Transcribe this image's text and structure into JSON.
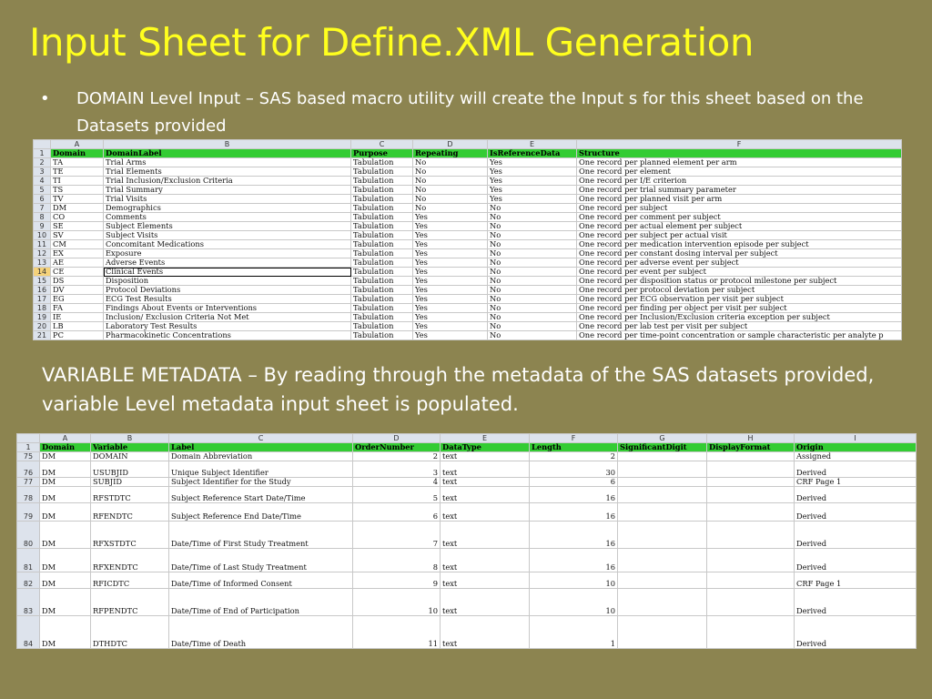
{
  "slide": {
    "title": "Input Sheet for Define.XML Generation",
    "bullet_marker": "•",
    "bullet_text": "DOMAIN Level Input – SAS based macro utility will create the Input s for this sheet based on the Datasets provided",
    "paragraph": "VARIABLE METADATA – By reading through the metadata of the SAS datasets provided, variable Level metadata input sheet is populated."
  },
  "domain_sheet": {
    "column_letters": [
      "A",
      "B",
      "C",
      "D",
      "E",
      "F"
    ],
    "header_row_number": "1",
    "headers": [
      "Domain",
      "DomainLabel",
      "Purpose",
      "Repeating",
      "IsReferenceData",
      "Structure"
    ],
    "selected_row": "14",
    "rows": [
      {
        "n": "2",
        "cells": [
          "TA",
          "Trial Arms",
          "Tabulation",
          "No",
          "Yes",
          "One record per planned element per arm"
        ]
      },
      {
        "n": "3",
        "cells": [
          "TE",
          "Trial Elements",
          "Tabulation",
          "No",
          "Yes",
          "One record per element"
        ]
      },
      {
        "n": "4",
        "cells": [
          "TI",
          "Trial Inclusion/Exclusion Criteria",
          "Tabulation",
          "No",
          "Yes",
          "One record per I/E criterion"
        ]
      },
      {
        "n": "5",
        "cells": [
          "TS",
          "Trial Summary",
          "Tabulation",
          "No",
          "Yes",
          "One record per trial summary parameter"
        ]
      },
      {
        "n": "6",
        "cells": [
          "TV",
          "Trial Visits",
          "Tabulation",
          "No",
          "Yes",
          "One record per planned visit per arm"
        ]
      },
      {
        "n": "7",
        "cells": [
          "DM",
          "Demographics",
          "Tabulation",
          "No",
          "No",
          "One record per subject"
        ]
      },
      {
        "n": "8",
        "cells": [
          "CO",
          "Comments",
          "Tabulation",
          "Yes",
          "No",
          "One record per comment per subject"
        ]
      },
      {
        "n": "9",
        "cells": [
          "SE",
          "Subject Elements",
          "Tabulation",
          "Yes",
          "No",
          "One record per actual element per subject"
        ]
      },
      {
        "n": "10",
        "cells": [
          "SV",
          "Subject Visits",
          "Tabulation",
          "Yes",
          "No",
          "One record per subject per actual visit"
        ]
      },
      {
        "n": "11",
        "cells": [
          "CM",
          "Concomitant Medications",
          "Tabulation",
          "Yes",
          "No",
          "One record per medication intervention episode per subject"
        ]
      },
      {
        "n": "12",
        "cells": [
          "EX",
          "Exposure",
          "Tabulation",
          "Yes",
          "No",
          "One record per constant dosing interval per subject"
        ]
      },
      {
        "n": "13",
        "cells": [
          "AE",
          "Adverse Events",
          "Tabulation",
          "Yes",
          "No",
          "One record per adverse event per subject"
        ]
      },
      {
        "n": "14",
        "cells": [
          "CE",
          "Clinical Events",
          "Tabulation",
          "Yes",
          "No",
          "One record per event per subject"
        ]
      },
      {
        "n": "15",
        "cells": [
          "DS",
          "Disposition",
          "Tabulation",
          "Yes",
          "No",
          "One record per disposition status or protocol milestone per subject"
        ]
      },
      {
        "n": "16",
        "cells": [
          "DV",
          "Protocol Deviations",
          "Tabulation",
          "Yes",
          "No",
          "One record per protocol deviation per subject"
        ]
      },
      {
        "n": "17",
        "cells": [
          "EG",
          "ECG Test Results",
          "Tabulation",
          "Yes",
          "No",
          "One record per ECG observation per visit per subject"
        ]
      },
      {
        "n": "18",
        "cells": [
          "FA",
          "Findings About Events or Interventions",
          "Tabulation",
          "Yes",
          "No",
          "One record per finding per object per visit per subject"
        ]
      },
      {
        "n": "19",
        "cells": [
          "IE",
          "Inclusion/ Exclusion Criteria Not Met",
          "Tabulation",
          "Yes",
          "No",
          "One record per Inclusion/Exclusion criteria exception per subject"
        ]
      },
      {
        "n": "20",
        "cells": [
          "LB",
          "Laboratory Test Results",
          "Tabulation",
          "Yes",
          "No",
          "One record per lab test per visit per subject"
        ]
      },
      {
        "n": "21",
        "cells": [
          "PC",
          "Pharmacokinetic Concentrations",
          "Tabulation",
          "Yes",
          "No",
          "One record per time-point concentration or sample characteristic per analyte p"
        ]
      }
    ]
  },
  "variable_sheet": {
    "column_letters": [
      "A",
      "B",
      "C",
      "D",
      "E",
      "F",
      "G",
      "H",
      "I"
    ],
    "header_row_number": "1",
    "headers": [
      "Domain",
      "Variable",
      "Label",
      "OrderNumber",
      "DataType",
      "Length",
      "SignificantDigit",
      "DisplayFormat",
      "Origin"
    ],
    "rows": [
      {
        "n": "75",
        "cells": [
          "DM",
          "DOMAIN",
          "Domain Abbreviation",
          "2",
          "text",
          "2",
          "",
          "",
          "Assigned"
        ]
      },
      {
        "n": "76",
        "cells": [
          "DM",
          "USUBJID",
          "Unique Subject Identifier",
          "3",
          "text",
          "30",
          "",
          "",
          "Derived"
        ]
      },
      {
        "n": "77",
        "cells": [
          "DM",
          "SUBJID",
          "Subject Identifier for the Study",
          "4",
          "text",
          "6",
          "",
          "",
          "CRF Page 1"
        ]
      },
      {
        "n": "78",
        "cells": [
          "DM",
          "RFSTDTC",
          "Subject Reference Start Date/Time",
          "5",
          "text",
          "16",
          "",
          "",
          "Derived"
        ]
      },
      {
        "n": "79",
        "cells": [
          "DM",
          "RFENDTC",
          "Subject Reference End Date/Time",
          "6",
          "text",
          "16",
          "",
          "",
          "Derived"
        ]
      },
      {
        "n": "80",
        "cells": [
          "DM",
          "RFXSTDTC",
          "Date/Time of First Study Treatment",
          "7",
          "text",
          "16",
          "",
          "",
          "Derived"
        ]
      },
      {
        "n": "81",
        "cells": [
          "DM",
          "RFXENDTC",
          "Date/Time of Last Study Treatment",
          "8",
          "text",
          "16",
          "",
          "",
          "Derived"
        ]
      },
      {
        "n": "82",
        "cells": [
          "DM",
          "RFICDTC",
          "Date/Time of Informed Consent",
          "9",
          "text",
          "10",
          "",
          "",
          "CRF Page 1"
        ]
      },
      {
        "n": "83",
        "cells": [
          "DM",
          "RFPENDTC",
          "Date/Time of End of Participation",
          "10",
          "text",
          "10",
          "",
          "",
          "Derived"
        ]
      },
      {
        "n": "84",
        "cells": [
          "DM",
          "DTHDTC",
          "Date/Time of Death",
          "11",
          "text",
          "1",
          "",
          "",
          "Derived"
        ]
      }
    ]
  }
}
